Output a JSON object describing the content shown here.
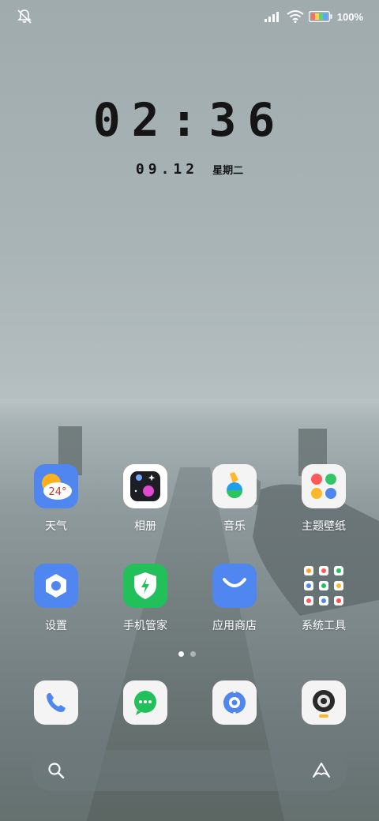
{
  "status_bar": {
    "battery_percent": "100%",
    "icons": [
      "bell-off-icon",
      "signal-icon",
      "wifi-icon",
      "battery-icon"
    ]
  },
  "lock_clock": {
    "time": "02:36",
    "date": "09.12",
    "weekday": "星期二"
  },
  "home_grid": {
    "row1": [
      {
        "label": "天气",
        "icon": "weather-icon",
        "badge": "24°"
      },
      {
        "label": "相册",
        "icon": "gallery-icon"
      },
      {
        "label": "音乐",
        "icon": "music-icon"
      },
      {
        "label": "主题壁纸",
        "icon": "theme-icon"
      }
    ],
    "row2": [
      {
        "label": "设置",
        "icon": "settings-icon"
      },
      {
        "label": "手机管家",
        "icon": "phone-manager-icon"
      },
      {
        "label": "应用商店",
        "icon": "app-store-icon"
      },
      {
        "label": "系统工具",
        "icon": "system-tools-folder-icon"
      }
    ]
  },
  "page_indicator": {
    "pages": 2,
    "current": 1
  },
  "dock": {
    "apps": [
      "phone-icon",
      "messages-icon",
      "browser-icon",
      "camera-icon"
    ]
  },
  "search_bar": {
    "icons": [
      "search-icon",
      "assistant-icon"
    ]
  },
  "colors": {
    "accent_blue": "#4a7ff0",
    "green": "#21c05a",
    "text": "#151515"
  }
}
